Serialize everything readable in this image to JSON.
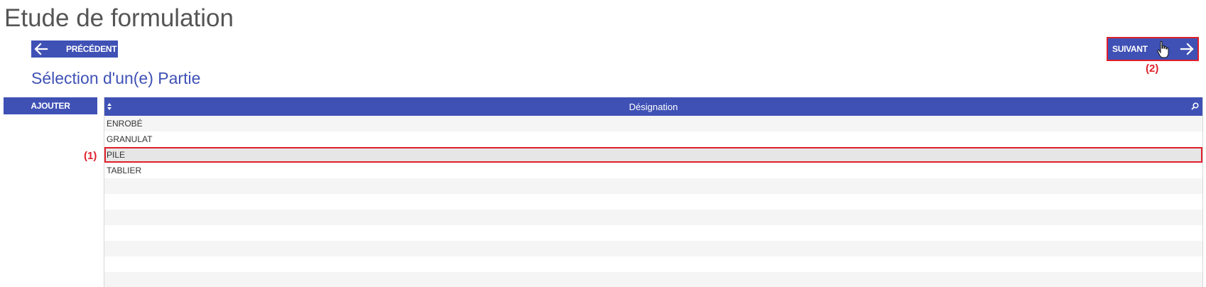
{
  "page": {
    "title": "Etude de formulation",
    "subtitle": "Sélection d'un(e) Partie"
  },
  "nav": {
    "prev_label": "PRÉCÉDENT",
    "next_label": "SUIVANT"
  },
  "toolbar": {
    "add_label": "AJOUTER"
  },
  "table": {
    "column": "Désignation",
    "rows": [
      "ENROBÉ",
      "GRANULAT",
      "PILE",
      "TABLIER"
    ],
    "selected_index": 2
  },
  "annotations": {
    "row_marker": "(1)",
    "next_marker": "(2)"
  },
  "colors": {
    "primary": "#3f51b5",
    "highlight": "#e0202a",
    "title_gray": "#555555"
  },
  "icons": {
    "prev": "arrow-left-icon",
    "next": "arrow-right-icon",
    "cursor": "hand-pointer-icon",
    "sort": "sort-icon",
    "search": "search-icon"
  }
}
